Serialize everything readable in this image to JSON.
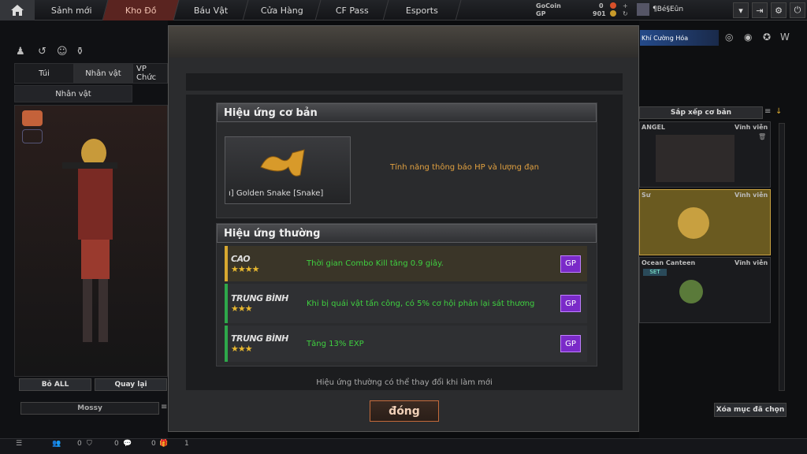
{
  "topbar": {
    "tabs": [
      "Sảnh mới",
      "Kho Đồ",
      "Báu Vật",
      "Cửa Hàng",
      "CF Pass",
      "Esports"
    ],
    "gocoin_label": "GoCoin",
    "gp_label": "GP",
    "gocoin_value": "0",
    "gp_value": "901",
    "username": "¶Bé§Eûn",
    "promo": "Khí Cường Hóa"
  },
  "left": {
    "tabs": [
      "Túi",
      "Nhân vật",
      "VP Chức"
    ],
    "subtab": "Nhân vật",
    "btn_reset": "Bỏ ALL",
    "btn_back": "Quay lại",
    "char_name": "Mossy"
  },
  "right": {
    "sort_label": "Sắp xếp cơ bản",
    "slots": [
      {
        "name": "ANGEL",
        "duration": "Vĩnh viễn"
      },
      {
        "name": "Sư",
        "duration": "Vĩnh viễn"
      },
      {
        "name": "Ocean Canteen",
        "duration": "Vĩnh viễn",
        "tag": "SET"
      }
    ],
    "delete_btn": "Xóa mục đã chọn"
  },
  "modal": {
    "basic_title": "Hiệu ứng cơ bản",
    "item_name": "ı] Golden Snake [Snake]",
    "basic_desc": "Tính năng thông báo HP và lượng đạn",
    "normal_title": "Hiệu ứng thường",
    "rows": [
      {
        "tier": "CAO",
        "stars": "★★★★",
        "text": "Thời gian Combo Kill tăng 0.9 giây.",
        "color": "#d8a830"
      },
      {
        "tier": "TRUNG BÌNH",
        "stars": "★★★",
        "text": "Khi bị quái vật tấn công, có 5% cơ hội phản lại sát thương",
        "color": "#2ea84a"
      },
      {
        "tier": "TRUNG BÌNH",
        "stars": "★★★",
        "text": "Tăng 13% EXP",
        "color": "#2ea84a"
      }
    ],
    "note": "Hiệu ứng thường có thể thay đổi khi làm mới",
    "close_label": "đóng"
  },
  "bottombar": {
    "v1": "0",
    "v2": "0",
    "v3": "0",
    "v4": "1"
  }
}
